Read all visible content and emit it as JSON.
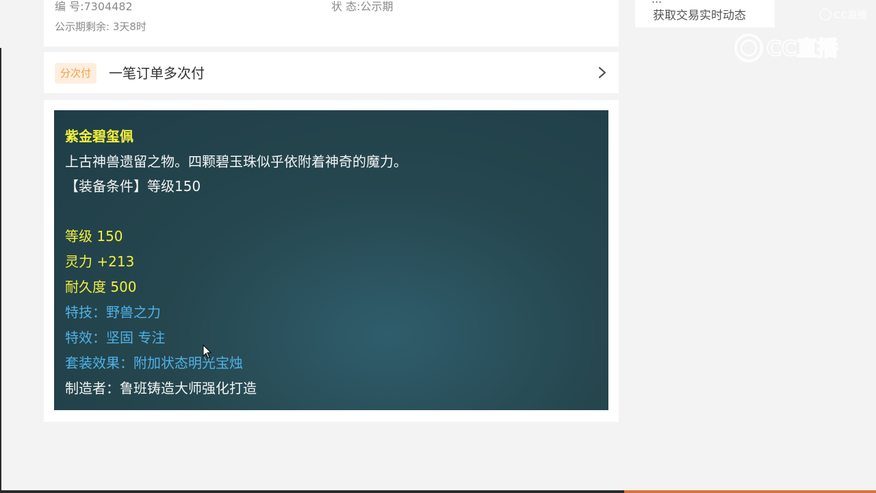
{
  "order_info": {
    "number": "编 号:7304482",
    "status": "状 态:公示期",
    "remaining": "公示期剩余: 3天8时"
  },
  "installment": {
    "badge": "分次付",
    "text": "一笔订单多次付",
    "icon": "chevron-right-icon"
  },
  "item": {
    "name": "紫金碧玺佩",
    "description": "上古神兽遗留之物。四颗碧玉珠似乎依附着神奇的魔力。",
    "requirement": "【装备条件】等级150",
    "level": "等级 150",
    "spirit": "灵力 +213",
    "durability": "耐久度 500",
    "skill": "特技：野兽之力",
    "effect": "特效：坚固 专注",
    "set_effect": "套装效果：附加状态明光宝烛",
    "maker": "制造者：鲁班铸造大师强化打造"
  },
  "side_panel": {
    "partial_text": "…",
    "label": "获取交易实时动态"
  },
  "watermark": {
    "text": "CC直播",
    "icon": "cc-live-logo"
  },
  "colors": {
    "yellow": "#f5f13a",
    "blue": "#4fb2e8",
    "badge_text": "#f0a048",
    "badge_bg": "#fdeede",
    "panel_bg": "#26474f"
  }
}
